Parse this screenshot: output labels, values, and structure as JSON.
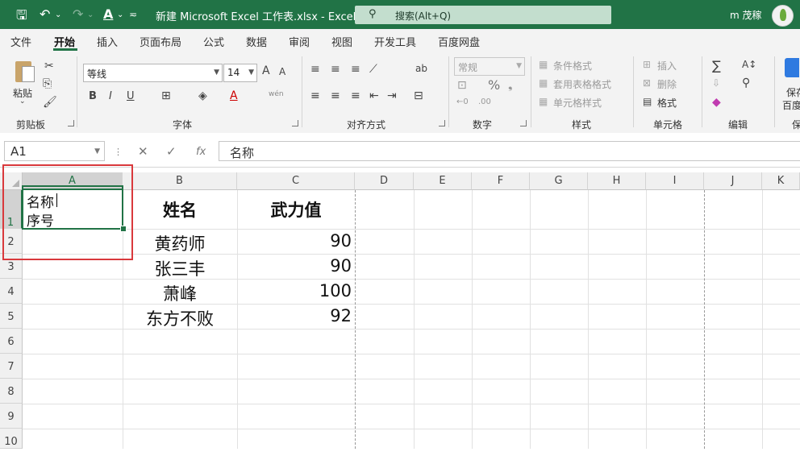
{
  "titlebar": {
    "doc_title": "新建 Microsoft Excel 工作表.xlsx  -  Excel",
    "search_placeholder": "搜索(Alt+Q)",
    "user_name": "m 茂稼",
    "icons": [
      "save-icon",
      "undo-icon",
      "redo-icon",
      "font-color-icon",
      "customize-icon",
      "search-icon"
    ],
    "accent": "#217346"
  },
  "menu": {
    "tabs": [
      "文件",
      "开始",
      "插入",
      "页面布局",
      "公式",
      "数据",
      "审阅",
      "视图",
      "开发工具",
      "百度网盘"
    ],
    "active": "开始"
  },
  "ribbon": {
    "clipboard": {
      "paste": "粘贴",
      "label": "剪贴板"
    },
    "font": {
      "name": "等线",
      "size": "14",
      "grow": "A",
      "shrink": "A",
      "bold": "B",
      "italic": "I",
      "underline": "U",
      "phonetic": "wén",
      "label": "字体"
    },
    "alignment": {
      "label": "对齐方式"
    },
    "number": {
      "format": "常规",
      "percent": "%",
      "label": "数字"
    },
    "styles": {
      "conditional": "条件格式",
      "table": "套用表格格式",
      "cell": "单元格样式",
      "label": "样式"
    },
    "cells": {
      "insert": "插入",
      "delete": "删除",
      "format": "格式",
      "label": "单元格"
    },
    "editing": {
      "sigma": "∑",
      "label": "编辑"
    },
    "baidu": {
      "save": "保存",
      "to": "百度",
      "label": "保"
    }
  },
  "formula_bar": {
    "name_box": "A1",
    "cancel": "✕",
    "enter": "✓",
    "fx": "fx",
    "content": "名称"
  },
  "grid": {
    "columns": [
      "A",
      "B",
      "C",
      "D",
      "E",
      "F",
      "G",
      "H",
      "I",
      "J",
      "K"
    ],
    "rows": [
      "1",
      "2",
      "3",
      "4",
      "5",
      "6",
      "7",
      "8",
      "9",
      "10"
    ],
    "selected_cell": "A1",
    "a1_line1": "名称",
    "a1_line2": "序号",
    "headers": {
      "name": "姓名",
      "force": "武力值"
    },
    "data": [
      {
        "name": "黄药师",
        "force": "90"
      },
      {
        "name": "张三丰",
        "force": "90"
      },
      {
        "name": "萧峰",
        "force": "100"
      },
      {
        "name": "东方不败",
        "force": "92"
      }
    ],
    "highlight_color": "#d9393c"
  }
}
